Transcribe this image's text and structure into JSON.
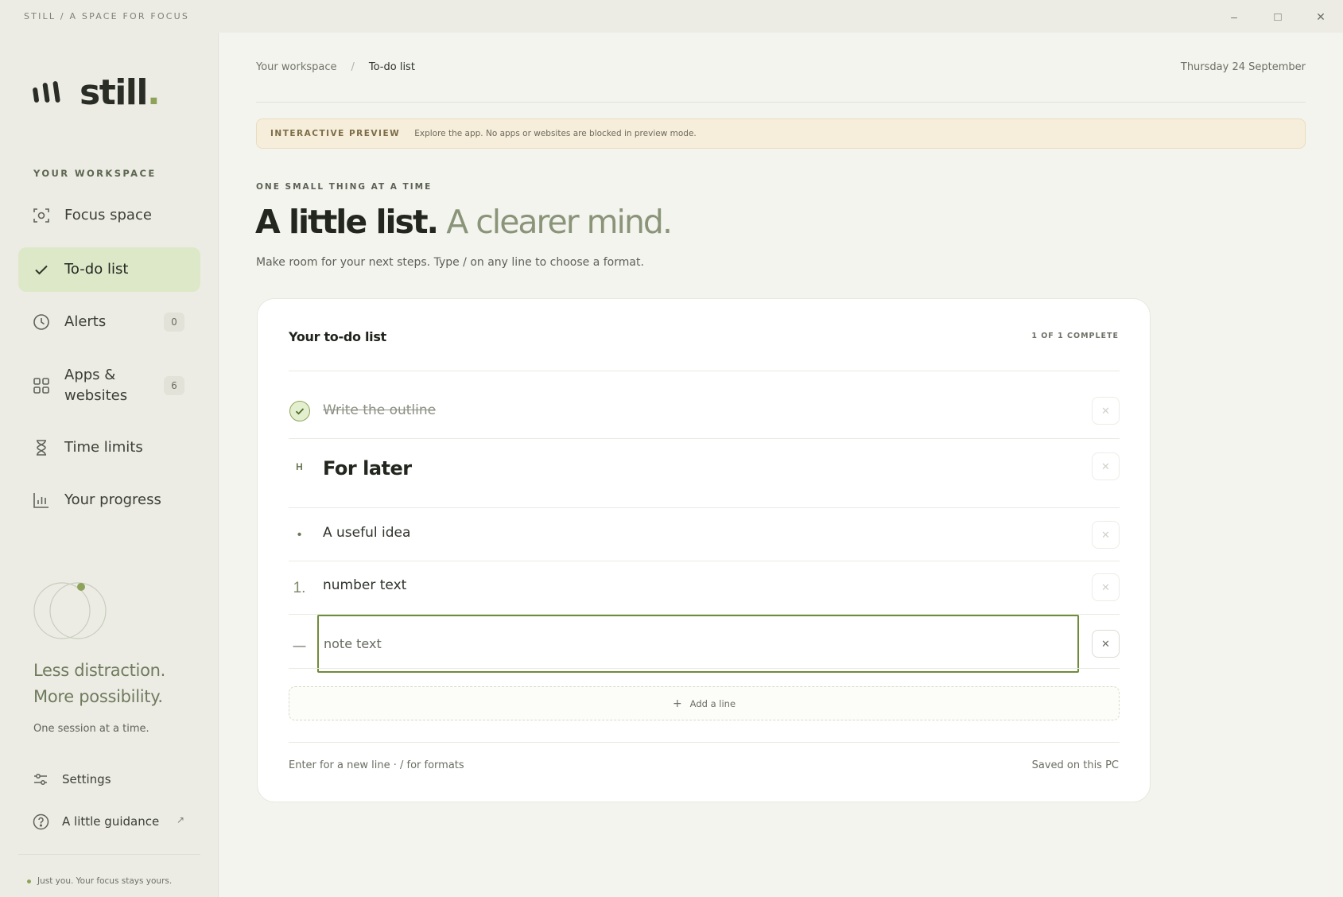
{
  "window": {
    "caption": "STILL / A SPACE FOR FOCUS",
    "minimize_glyph": "–",
    "maximize_glyph": "□",
    "close_glyph": "✕"
  },
  "sidebar": {
    "logo_text": "still",
    "logo_dot": ".",
    "section_label": "YOUR WORKSPACE",
    "items": [
      {
        "label": "Focus space",
        "icon": "focus-icon",
        "badge": null
      },
      {
        "label": "To-do list",
        "icon": "check-icon",
        "badge": null
      },
      {
        "label": "Alerts",
        "icon": "clock-icon",
        "badge": "0"
      },
      {
        "label": "Apps & websites",
        "icon": "grid-icon",
        "badge": "6"
      },
      {
        "label": "Time limits",
        "icon": "hourglass-icon",
        "badge": null
      },
      {
        "label": "Your progress",
        "icon": "bar-chart-icon",
        "badge": null
      }
    ],
    "active_item": "To-do list",
    "tagline_1": "Less distraction.",
    "tagline_2": "More possibility.",
    "tagline_sub": "One session at a time.",
    "settings_label": "Settings",
    "guidance_label": "A little guidance",
    "guidance_arrow": "↗",
    "footer_text": "Just you. Your focus stays yours."
  },
  "main": {
    "breadcrumb": {
      "parent": "Your workspace",
      "separator": "/",
      "current": "To-do list"
    },
    "date": "Thursday 24 September",
    "banner": {
      "tag": "INTERACTIVE PREVIEW",
      "text": "Explore the app. No apps or websites are blocked in preview mode."
    },
    "eyebrow": "ONE SMALL THING AT A TIME",
    "headline_dark": "A little list.",
    "headline_light": "A clearer mind.",
    "subline": "Make room for your next steps. Type / on any line to choose a format."
  },
  "todo": {
    "title": "Your to-do list",
    "count": "1 OF 1 COMPLETE",
    "rows": [
      {
        "type": "task",
        "text": "Write the outline",
        "done": true
      },
      {
        "type": "heading",
        "marker": "H",
        "text": "For later"
      },
      {
        "type": "bullet",
        "marker": "•",
        "text": "A useful idea"
      },
      {
        "type": "numbered",
        "marker": "1.",
        "text": "number text"
      },
      {
        "type": "note",
        "marker": "—",
        "text": "note text"
      }
    ],
    "add_line_label": "Add a line",
    "add_line_glyph": "+",
    "remove_glyph": "✕",
    "footer_hint": "Enter for a new line · / for formats",
    "footer_saved": "Saved on this PC"
  },
  "colors": {
    "accent": "#8ea35a",
    "active_nav_bg": "#dde8c9",
    "focus_border": "#6f8c3a",
    "banner_bg": "#f6eddb"
  }
}
